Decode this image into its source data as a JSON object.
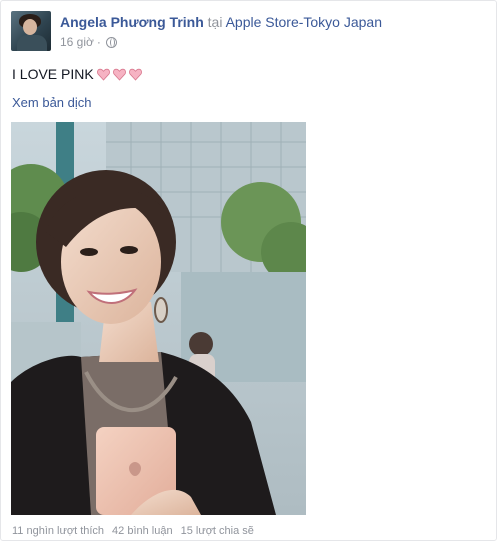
{
  "post": {
    "author": "Angela Phương Trinh",
    "location_prefix": "tại",
    "location": "Apple Store-Tokyo Japan",
    "time": "16 giờ",
    "privacy_separator": "·",
    "privacy_icon": "globe-icon",
    "status_text": "I LOVE PINK",
    "emoji": [
      "pink-heart",
      "pink-heart",
      "pink-heart"
    ],
    "translate_link": "Xem bản dịch"
  },
  "stats": {
    "likes": "11 nghìn lượt thích",
    "comments": "42 bình luận",
    "shares": "15 lượt chia sẽ"
  },
  "colors": {
    "link": "#3b5998",
    "muted": "#90949c",
    "text": "#141823",
    "heart": "#f3a6b8"
  }
}
